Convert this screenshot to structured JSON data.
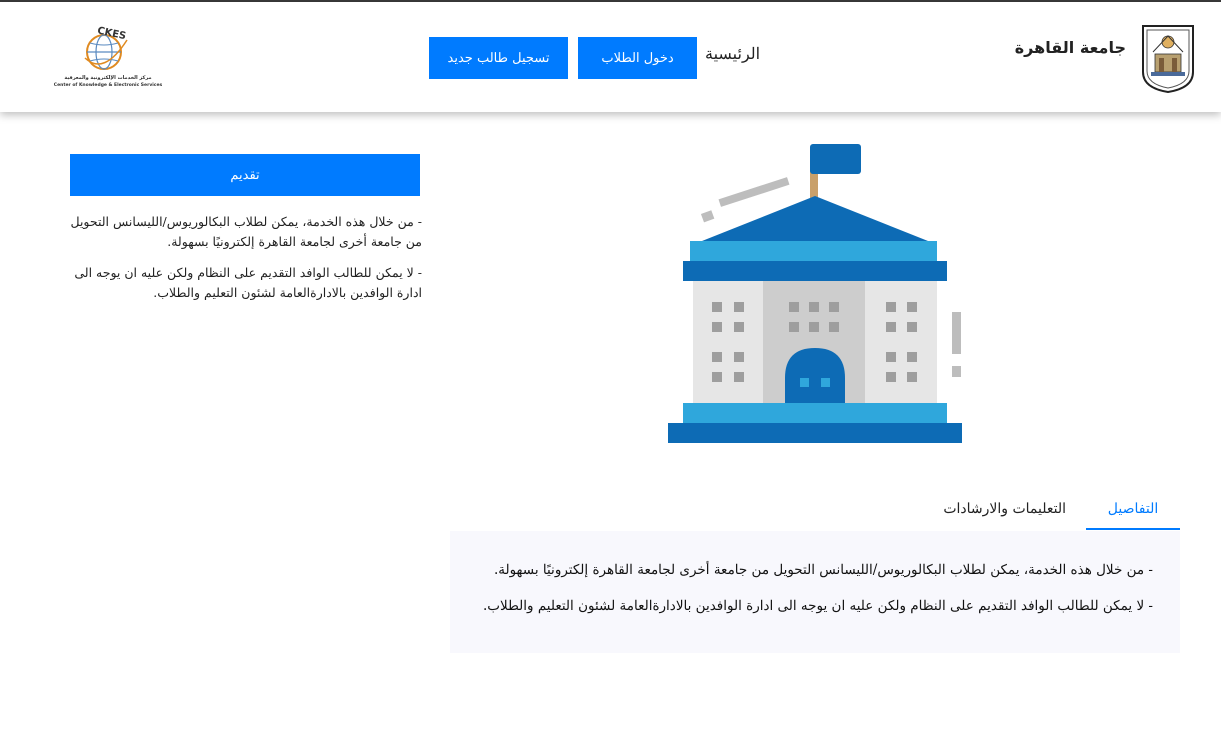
{
  "header": {
    "university_name": "جامعة القاهرة",
    "nav_home": "الرئيسية",
    "login_button": "دخول الطلاب",
    "register_button": "تسجيل طالب جديد",
    "ckes_logo": {
      "acronym": "CKES",
      "arabic_name": "مركز الخدمات الإلكترونية والمعرفية",
      "english_name": "Center of Knowledge & Electronic Services"
    }
  },
  "sidebar": {
    "apply_button": "تقديم",
    "paragraphs": [
      "- من خلال هذه الخدمة، يمكن لطلاب البكالوريوس/الليسانس التحويل من جامعة أخرى لجامعة القاهرة إلكترونيًا بسهولة.",
      "- لا يمكن للطالب الوافد التقديم على النظام ولكن عليه ان يوجه الى ادارة الوافدين بالادارةالعامة لشئون التعليم والطلاب."
    ]
  },
  "tabs": {
    "details": "التفاصيل",
    "instructions": "التعليمات والارشادات",
    "active": "details"
  },
  "details_panel": {
    "paragraphs": [
      "- من خلال هذه الخدمة، يمكن لطلاب البكالوريوس/الليسانس التحويل من جامعة أخرى لجامعة القاهرة إلكترونيًا بسهولة.",
      "- لا يمكن للطالب الوافد التقديم على النظام ولكن عليه ان يوجه الى ادارة الوافدين بالادارةالعامة لشئون التعليم والطلاب."
    ]
  },
  "colors": {
    "primary": "#007bff",
    "building_dark": "#0d6bb5",
    "building_light": "#2fa7dc",
    "panel_bg": "#f8f8fd"
  },
  "icons": {
    "university_logo": "cairo-university-crest-icon",
    "ckes_logo": "globe-icon",
    "illustration": "university-building-icon"
  }
}
